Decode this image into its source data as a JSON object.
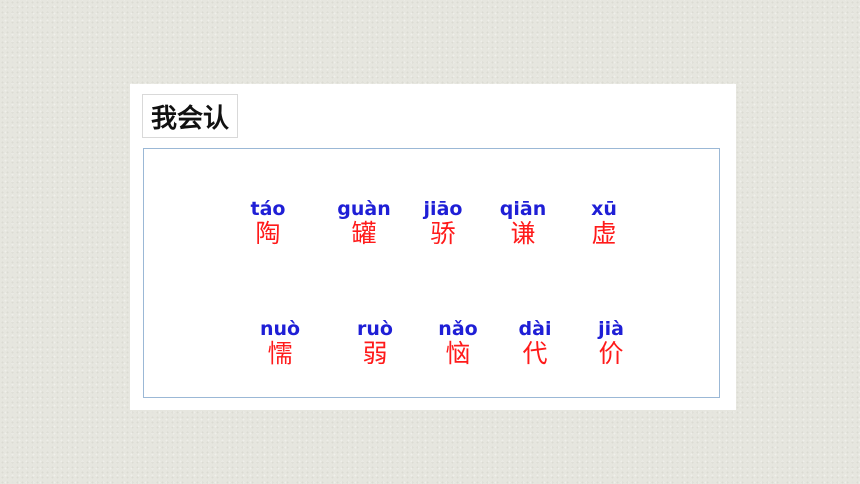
{
  "section": {
    "title": "我会认"
  },
  "rows": [
    {
      "items": [
        {
          "pinyin": "táo",
          "hanzi": "陶"
        },
        {
          "pinyin": "guàn",
          "hanzi": "罐"
        },
        {
          "pinyin": "jiāo",
          "hanzi": "骄"
        },
        {
          "pinyin": "qiān",
          "hanzi": "谦"
        },
        {
          "pinyin": "xū",
          "hanzi": "虚"
        }
      ]
    },
    {
      "items": [
        {
          "pinyin": "nuò",
          "hanzi": "懦"
        },
        {
          "pinyin": "ruò",
          "hanzi": "弱"
        },
        {
          "pinyin": "nǎo",
          "hanzi": "恼"
        },
        {
          "pinyin": "dài",
          "hanzi": "代"
        },
        {
          "pinyin": "jià",
          "hanzi": "价"
        }
      ]
    }
  ],
  "colors": {
    "pinyin": "#1f1fd6",
    "hanzi": "#ff1a1a",
    "border": "#9bb8d6"
  }
}
